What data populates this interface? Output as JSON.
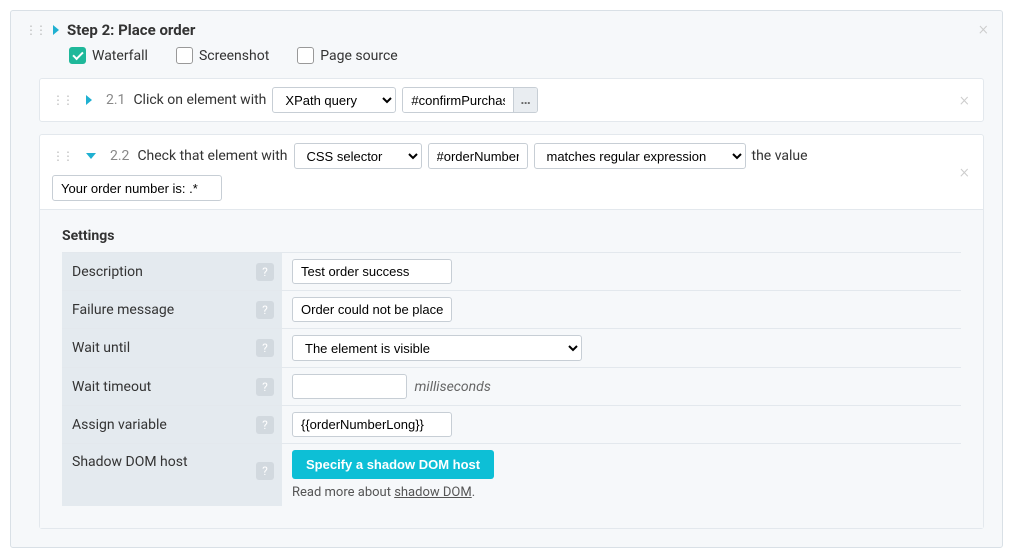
{
  "step": {
    "title": "Step 2: Place order"
  },
  "options": {
    "waterfall": "Waterfall",
    "screenshot": "Screenshot",
    "page_source": "Page source"
  },
  "sub1": {
    "num": "2.1",
    "text": "Click on element with",
    "selector_type": "XPath query",
    "selector_value": "#confirmPurchase"
  },
  "sub2": {
    "num": "2.2",
    "text": "Check that element with",
    "selector_type": "CSS selector",
    "selector_value": "#orderNumber",
    "match_type": "matches regular expression",
    "the_value_label": "the value",
    "the_value": "Your order number is: .*"
  },
  "settings": {
    "heading": "Settings",
    "description": {
      "label": "Description",
      "value": "Test order success"
    },
    "failure": {
      "label": "Failure message",
      "value": "Order could not be placed"
    },
    "wait_until": {
      "label": "Wait until",
      "value": "The element is visible"
    },
    "wait_timeout": {
      "label": "Wait timeout",
      "value": "",
      "unit": "milliseconds"
    },
    "assign_var": {
      "label": "Assign variable",
      "value": "{{orderNumberLong}}"
    },
    "shadow": {
      "label": "Shadow DOM host",
      "button": "Specify a shadow DOM host",
      "readmore_prefix": "Read more about ",
      "readmore_link": "shadow DOM",
      "readmore_suffix": "."
    }
  }
}
